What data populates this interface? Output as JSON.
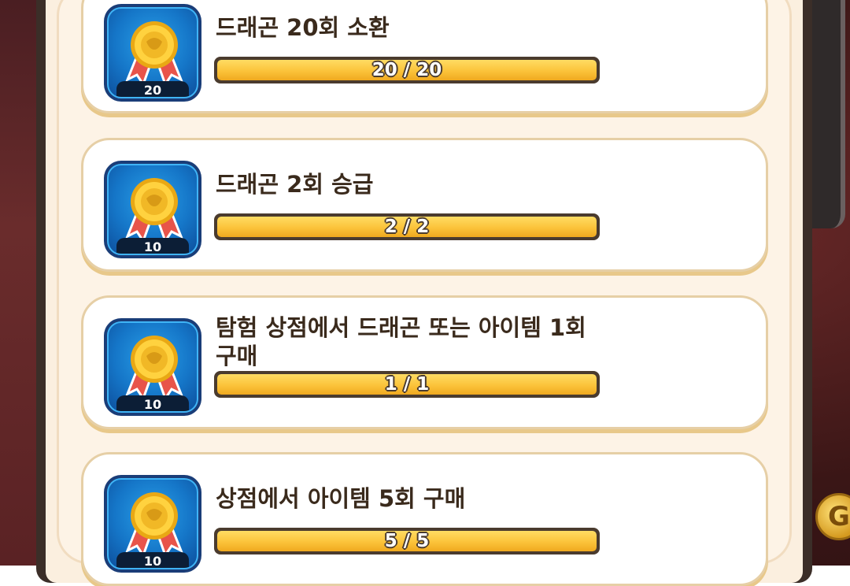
{
  "colors": {
    "progress_fill": "#fbc33a",
    "card_border": "#e6cfa6",
    "badge_blue": "#1576c8",
    "title_text": "#3a2a1c"
  },
  "side_coin": {
    "label": "G",
    "icon": "gold-coin-icon"
  },
  "missions": [
    {
      "title": "드래곤 20회 소환",
      "reward_count": "20",
      "progress_text": "20 / 20",
      "progress_fraction": 1.0,
      "icon": "gold-medal-icon"
    },
    {
      "title": "드래곤 2회 승급",
      "reward_count": "10",
      "progress_text": "2 / 2",
      "progress_fraction": 1.0,
      "icon": "gold-medal-icon"
    },
    {
      "title_line1": "탐험 상점에서 드래곤 또는 아이템 1회",
      "title_line2": "구매",
      "reward_count": "10",
      "progress_text": "1 / 1",
      "progress_fraction": 1.0,
      "icon": "gold-medal-icon"
    },
    {
      "title": "상점에서 아이템 5회 구매",
      "reward_count": "10",
      "progress_text": "5 / 5",
      "progress_fraction": 1.0,
      "icon": "gold-medal-icon"
    }
  ]
}
